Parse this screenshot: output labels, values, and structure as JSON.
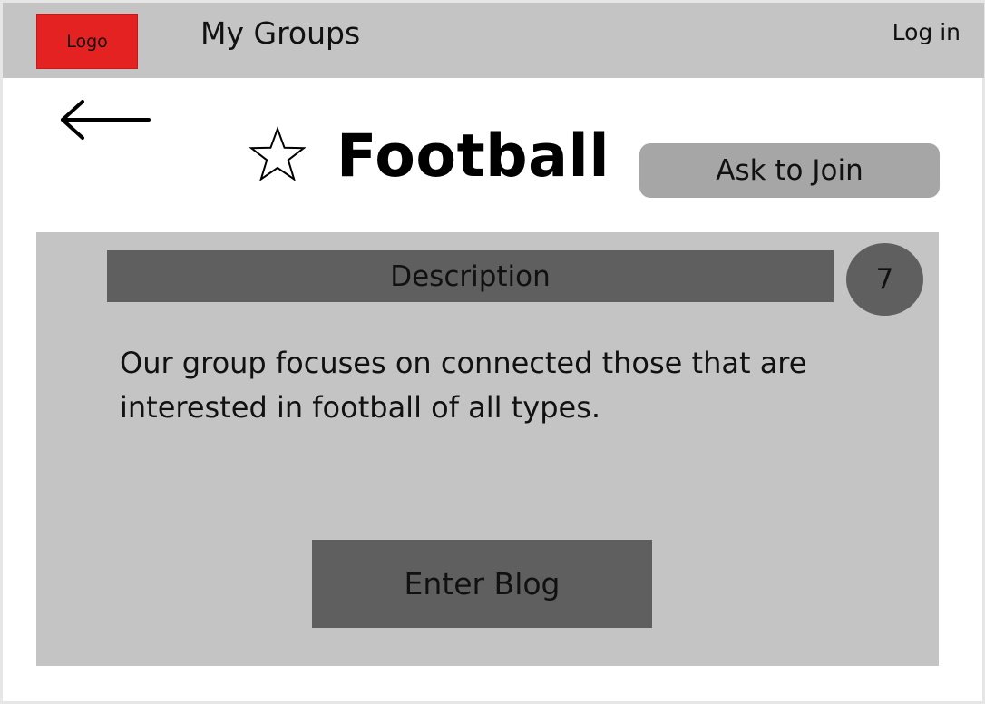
{
  "header": {
    "logo_label": "Logo",
    "nav_title": "My Groups",
    "login_label": "Log in"
  },
  "group": {
    "title": "Football",
    "join_label": "Ask to Join"
  },
  "panel": {
    "description_heading": "Description",
    "count": "7",
    "description_text": "Our group focuses on connected those that are interested in football of all types.",
    "blog_button_label": "Enter Blog"
  },
  "colors": {
    "header_bg": "#c4c4c4",
    "logo_bg": "#e52222",
    "button_bg": "#a6a6a6",
    "panel_bg": "#c4c4c4",
    "dark_block": "#5f5f5f"
  },
  "icons": {
    "back": "left-arrow-icon",
    "favorite": "star-outline-icon"
  }
}
